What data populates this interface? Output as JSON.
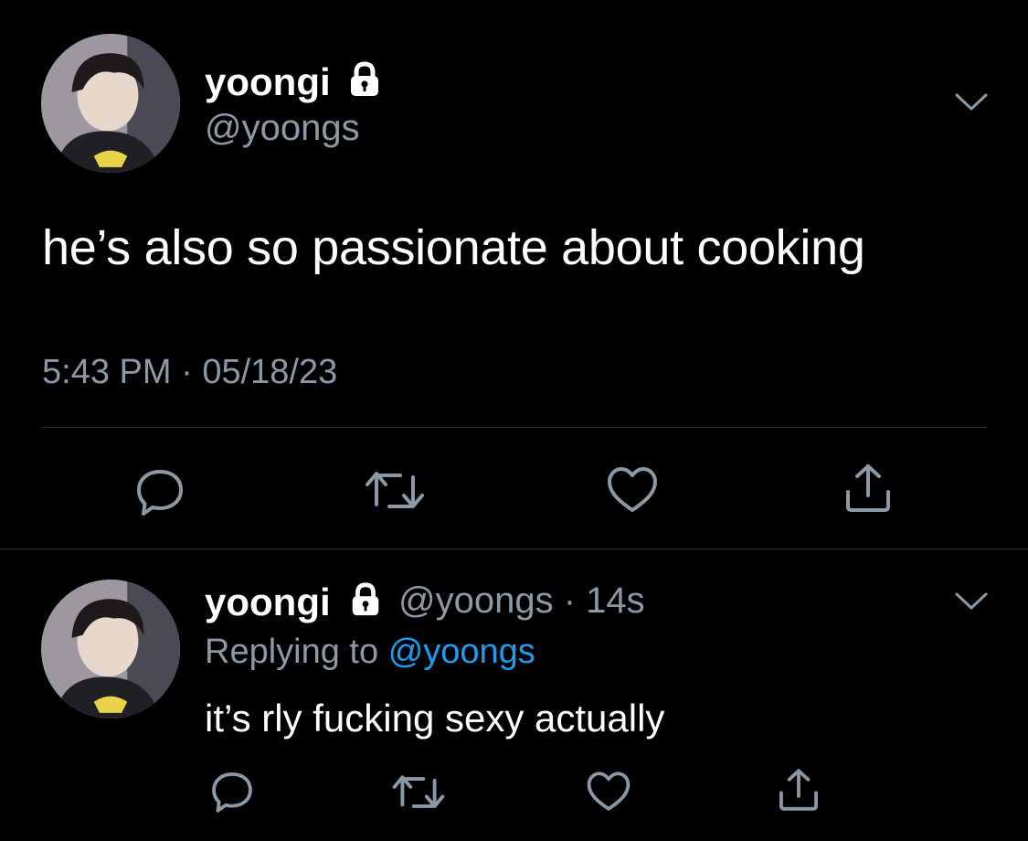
{
  "main_tweet": {
    "display_name": "yoongi",
    "handle": "@yoongs",
    "text": "he’s also so passionate about cooking",
    "time": "5:43 PM",
    "separator": "·",
    "date": "05/18/23",
    "icons": {
      "protected": "lock-icon",
      "menu": "chevron-down-icon",
      "reply": "comment-icon",
      "retweet": "retweet-icon",
      "like": "heart-icon",
      "share": "share-icon"
    }
  },
  "reply_tweet": {
    "display_name": "yoongi",
    "handle": "@yoongs",
    "separator": "·",
    "age": "14s",
    "replying_prefix": "Replying to",
    "replying_to": "@yoongs",
    "text": "it’s rly fucking sexy actually"
  },
  "colors": {
    "background": "#000000",
    "text": "#ffffff",
    "muted": "#8b98a5",
    "link": "#1d9bf0",
    "divider": "#2f3336"
  }
}
